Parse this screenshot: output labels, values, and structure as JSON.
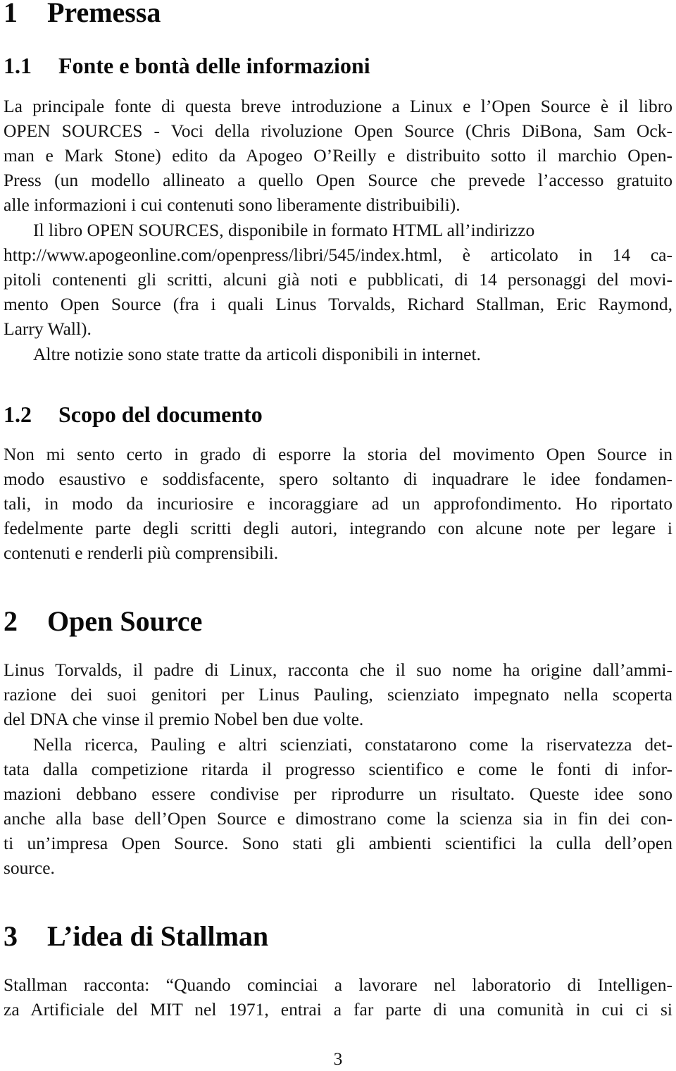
{
  "sections": {
    "s1": {
      "number": "1",
      "title": "Premessa"
    },
    "s1_1": {
      "number": "1.1",
      "title": "Fonte e bontà delle informazioni",
      "p1": [
        "La principale fonte di questa breve introduzione a Linux e l’Open Source è il libro",
        "OPEN SOURCES - Voci della rivoluzione Open Source (Chris DiBona, Sam Ock-",
        "man e Mark Stone) edito da Apogeo O’Reilly e distribuito sotto il marchio Open-",
        "Press (un modello allineato a quello Open Source che prevede l’accesso gratuito",
        "alle informazioni i cui contenuti sono liberamente distribuibili)."
      ],
      "p2": [
        "Il libro OPEN SOURCES, disponibile in formato HTML all’indirizzo",
        "http://www.apogeonline.com/openpress/libri/545/index.html, è articolato in 14 ca-",
        "pitoli contenenti gli scritti, alcuni già noti e pubblicati, di 14 personaggi del movi-",
        "mento Open Source (fra i quali Linus Torvalds, Richard Stallman, Eric Raymond,",
        "Larry Wall)."
      ],
      "p3": [
        "Altre notizie sono state tratte da articoli disponibili in internet."
      ]
    },
    "s1_2": {
      "number": "1.2",
      "title": "Scopo del documento",
      "p1": [
        "Non mi sento certo in grado di esporre la storia del movimento Open Source in",
        "modo esaustivo e soddisfacente, spero soltanto di inquadrare le idee fondamen-",
        "tali, in modo da incuriosire e incoraggiare ad un approfondimento.  Ho riportato",
        "fedelmente parte degli scritti degli autori, integrando con alcune note per legare i",
        "contenuti e renderli più comprensibili."
      ]
    },
    "s2": {
      "number": "2",
      "title": "Open Source",
      "p1": [
        "Linus Torvalds, il padre di Linux, racconta che il suo nome ha origine dall’ammi-",
        "razione dei suoi genitori per Linus Pauling, scienziato impegnato nella scoperta",
        "del DNA che vinse il premio Nobel ben due volte."
      ],
      "p2": [
        "Nella ricerca, Pauling e altri scienziati, constatarono come la riservatezza det-",
        "tata dalla competizione ritarda il progresso scientifico e come le fonti di infor-",
        "mazioni debbano essere condivise per riprodurre un risultato.  Queste idee sono",
        "anche alla base dell’Open Source e dimostrano come la scienza sia in fin dei con-",
        "ti un’impresa Open Source.  Sono stati gli ambienti scientifici la culla dell’open",
        "source."
      ]
    },
    "s3": {
      "number": "3",
      "title": "L’idea di Stallman",
      "p1": [
        "Stallman racconta:  “Quando cominciai a lavorare nel laboratorio di Intelligen-",
        "za Artificiale del MIT nel 1971, entrai a far parte di una comunità in cui ci si"
      ]
    }
  },
  "page_number": "3"
}
